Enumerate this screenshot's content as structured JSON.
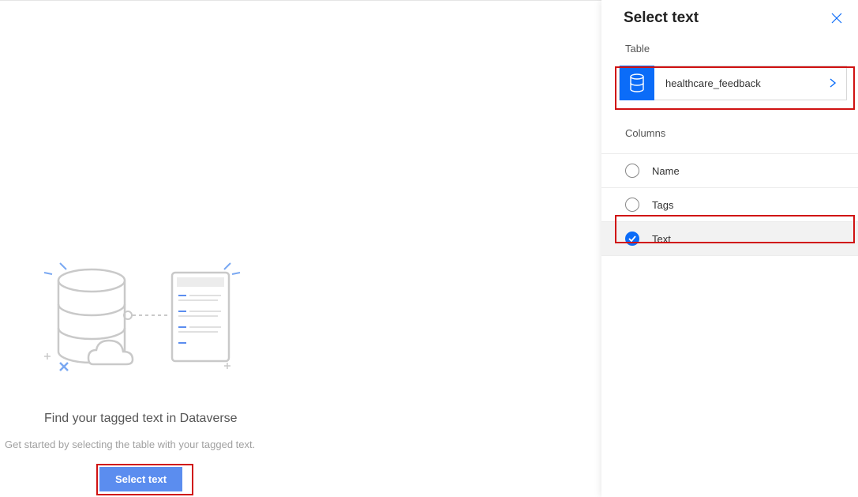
{
  "main": {
    "heading": "Find your tagged text in Dataverse",
    "subtext": "Get started by selecting the table with your tagged text.",
    "button_label": "Select text"
  },
  "panel": {
    "title": "Select text",
    "table_section_label": "Table",
    "table_name": "healthcare_feedback",
    "columns_section_label": "Columns",
    "columns": [
      {
        "label": "Name",
        "selected": false
      },
      {
        "label": "Tags",
        "selected": false
      },
      {
        "label": "Text",
        "selected": true
      }
    ]
  }
}
